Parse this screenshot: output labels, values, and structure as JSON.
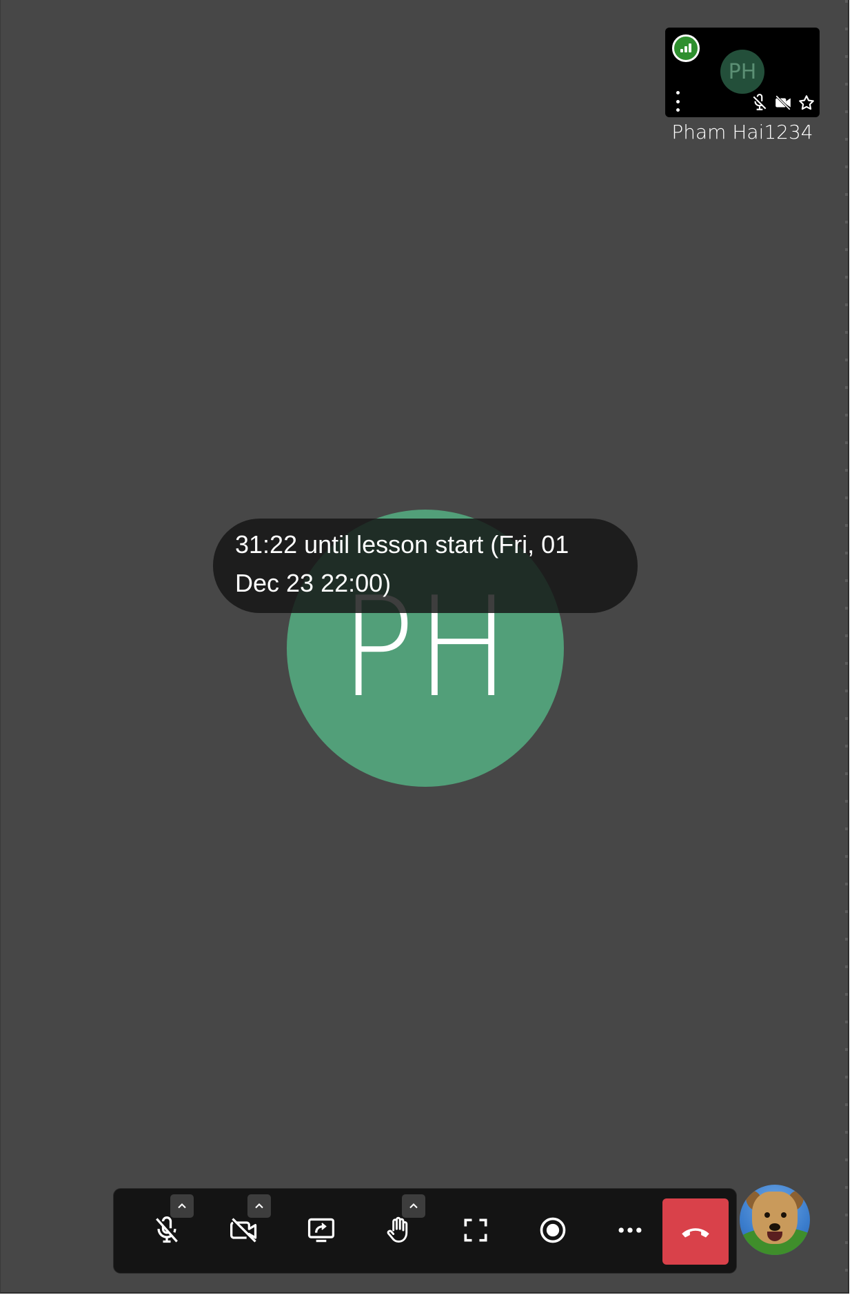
{
  "participant": {
    "initials": "PH",
    "name": "Pham Hai1234"
  },
  "notice": {
    "countdown_text": "31:22 until lesson start (Fri, 01 Dec 23 22:00)"
  },
  "colors": {
    "stage_background": "#474747",
    "avatar_green": "#529f79",
    "hangup_red": "#d9414a",
    "signal_green": "#2e8f2e"
  },
  "thumbnail": {
    "signal_icon": "connection-quality-icon",
    "menu_icon": "more-vertical-icon",
    "status_icons": [
      "mic-off-icon",
      "camera-off-icon",
      "star-icon"
    ]
  },
  "toolbar": {
    "buttons": [
      {
        "icon": "mic-off-icon",
        "has_caret": true
      },
      {
        "icon": "camera-off-icon",
        "has_caret": true
      },
      {
        "icon": "screen-share-icon",
        "has_caret": false
      },
      {
        "icon": "raise-hand-icon",
        "has_caret": true
      },
      {
        "icon": "fullscreen-icon",
        "has_caret": false
      },
      {
        "icon": "record-icon",
        "has_caret": false
      },
      {
        "icon": "more-horizontal-icon",
        "has_caret": false
      },
      {
        "icon": "hangup-icon",
        "has_caret": false
      }
    ]
  },
  "self_view": {
    "icon": "self-avatar-dog"
  }
}
